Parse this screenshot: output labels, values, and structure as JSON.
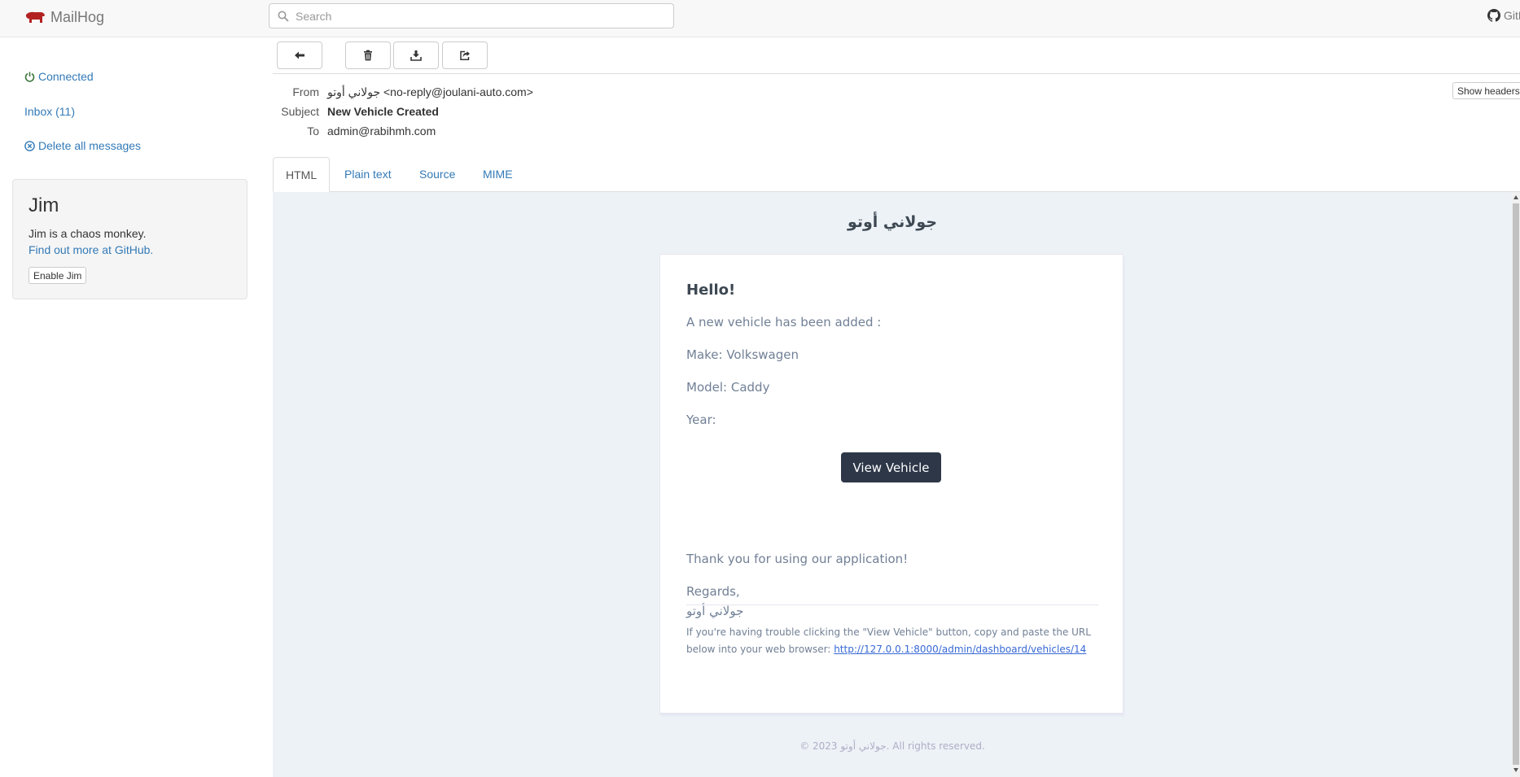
{
  "navbar": {
    "brand": "MailHog",
    "search_placeholder": "Search",
    "github_label": "GitHub"
  },
  "sidebar": {
    "connected": "Connected",
    "inbox": "Inbox (11)",
    "delete_all": "Delete all messages"
  },
  "jim": {
    "title": "Jim",
    "description": "Jim is a chaos monkey.",
    "link": "Find out more at GitHub.",
    "button": "Enable Jim"
  },
  "message": {
    "from_label": "From",
    "from_value": "جولاني أوتو <no-reply@joulani-auto.com>",
    "subject_label": "Subject",
    "subject_value": "New Vehicle Created",
    "to_label": "To",
    "to_value": "admin@rabihmh.com",
    "show_headers": "Show headers"
  },
  "tabs": [
    "HTML",
    "Plain text",
    "Source",
    "MIME"
  ],
  "email": {
    "title": "جولاني أوتو",
    "greeting": "Hello!",
    "intro": "A new vehicle has been added :",
    "make": "Make: Volkswagen",
    "model": "Model: Caddy",
    "year": "Year:",
    "button": "View Vehicle",
    "thanks": "Thank you for using our application!",
    "regards": "Regards,",
    "signature": "جولاني أوتو",
    "trouble_text": "If you're having trouble clicking the \"View Vehicle\" button, copy and paste the URL below into your web browser: ",
    "trouble_url": "http://127.0.0.1:8000/admin/dashboard/vehicles/14",
    "footer": "© 2023 جولاني أوتو. All rights reserved."
  },
  "colors": {
    "brand_icon": "#b22222",
    "link": "#337ab7",
    "connected": "#3c763d",
    "email_button": "#2d3748",
    "preview_background": "#edf2f7"
  }
}
